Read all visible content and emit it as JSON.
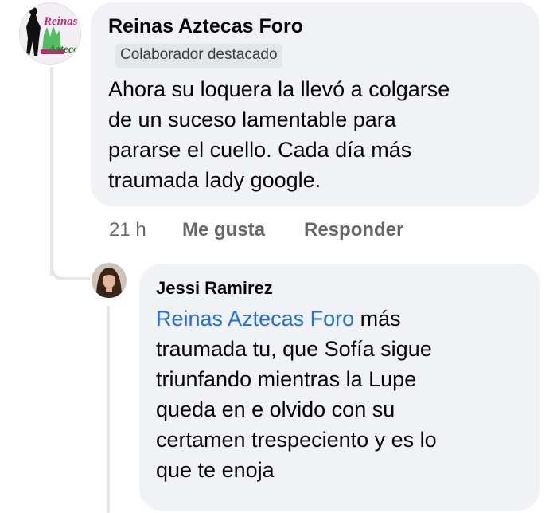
{
  "main_comment": {
    "author": "Reinas Aztecas Foro",
    "badge": "Colaborador destacado",
    "text": "Ahora su loquera la llevó a colgarse\nde un suceso lamentable para\npararse el cuello. Cada día más\ntraumada lady google.",
    "time": "21 h",
    "like_label": "Me gusta",
    "reply_label": "Responder",
    "avatar_logo_top": "Reinas",
    "avatar_logo_bottom": "Azteca"
  },
  "reply_comment": {
    "author": "Jessi Ramirez",
    "mention": "Reinas Aztecas Foro",
    "text_after_mention": " más\ntraumada tu, que Sofía sigue\ntriunfando mientras la Lupe\nqueda en e olvido con su\ncertamen trespeciento y es lo\nque te enoja"
  },
  "colors": {
    "bubble_bg": "#f0f2f5",
    "mention": "#216fdb",
    "secondary_text": "#65676b"
  }
}
